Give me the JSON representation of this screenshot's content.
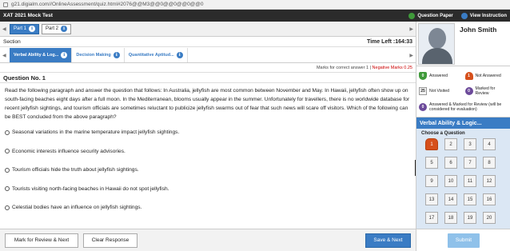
{
  "browser": {
    "url": "g21.digialm.com//OnlineAssessment/quiz.html#2076@@M3@@0@@0@@0@@0"
  },
  "header": {
    "title": "XAT 2021 Mock Test",
    "question_paper": "Question Paper",
    "view_instruction": "View Instruction",
    "question_paper_color": "#3f9a3a",
    "view_instruction_color": "#3a7cc4"
  },
  "parts": [
    {
      "label": "Part 1",
      "active": true
    },
    {
      "label": "Part 2",
      "active": false
    }
  ],
  "section_label": "Section",
  "time_left": "Time Left :164:33",
  "sections": [
    {
      "label": "Verbal Ability & Log...",
      "active": true
    },
    {
      "label": "Decision Making",
      "active": false
    },
    {
      "label": "Quantitative Aptitud...",
      "active": false
    }
  ],
  "marks": {
    "correct": "Marks for correct answer 1",
    "separator": " | ",
    "negative": "Negative Marks 0.25"
  },
  "question": {
    "number": "Question No. 1",
    "text": "Read the following paragraph and answer the question that follows: In Australia, jellyfish are most common between November and May. In Hawaii, jellyfish often show up on south-facing beaches eight days after a full moon. In the Mediterranean, blooms usually appear in the summer. Unfortunately for travellers, there is no worldwide database for recent jellyfish sightings, and tourism officials are sometimes reluctant to publicize jellyfish swarms out of fear that such news will scare off visitors. Which of the following can be BEST concluded from the above paragraph?",
    "options": [
      "Seasonal variations in the marine temperature impact jellyfish sightings.",
      "Economic interests influence security advisories.",
      "Tourism officials hide the truth about jellyfish sightings.",
      "Tourists visiting north-facing beaches in Hawaii do not spot jellyfish.",
      "Celestial bodies have an influence on jellyfish sightings."
    ]
  },
  "buttons": {
    "mark_review": "Mark for Review & Next",
    "clear": "Clear Response",
    "save_next": "Save & Next",
    "submit": "Submit"
  },
  "candidate": {
    "name": "John Smith"
  },
  "legend": {
    "answered": {
      "count": "0",
      "label": "Answered"
    },
    "not_answered": {
      "count": "1",
      "label": "Not Answered"
    },
    "not_visited": {
      "count": "25",
      "label": "Not Visited"
    },
    "marked": {
      "count": "0",
      "label": "Marked for Review"
    },
    "answered_marked": {
      "count": "0",
      "label": "Answered & Marked for Review (will be considered for evaluation)"
    }
  },
  "palette": {
    "section_title": "Verbal Ability & Logic...",
    "choose": "Choose a Question",
    "questions": [
      "1",
      "2",
      "3",
      "4",
      "5",
      "6",
      "7",
      "8",
      "9",
      "10",
      "11",
      "12",
      "13",
      "14",
      "15",
      "16",
      "17",
      "18",
      "19",
      "20"
    ],
    "current": "1"
  },
  "colors": {
    "accent": "#3a7cc4",
    "answered": "#3f9a3a",
    "not_answered": "#d6501c",
    "marked": "#6c4a9a"
  }
}
